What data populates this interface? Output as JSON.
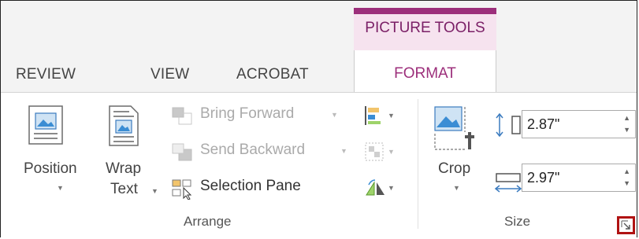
{
  "contextual_tab": {
    "label": "PICTURE TOOLS",
    "color": "#9c2f7b"
  },
  "tabs": [
    {
      "label": "REVIEW"
    },
    {
      "label": "VIEW"
    },
    {
      "label": "ACROBAT"
    },
    {
      "label": "FORMAT",
      "active": true
    }
  ],
  "arrange": {
    "position_label": "Position",
    "wrap_text_line1": "Wrap",
    "wrap_text_line2": "Text",
    "bring_forward": "Bring Forward",
    "send_backward": "Send Backward",
    "selection_pane": "Selection Pane",
    "group_label": "Arrange"
  },
  "size": {
    "crop_label": "Crop",
    "height_value": "2.87\"",
    "width_value": "2.97\"",
    "group_label": "Size"
  },
  "icons": {
    "position": "position-icon",
    "wrap_text": "wrap-text-icon",
    "bring_forward": "bring-forward-icon",
    "send_backward": "send-backward-icon",
    "selection_pane": "selection-pane-icon",
    "align": "align-icon",
    "group": "group-icon",
    "rotate": "rotate-icon",
    "crop": "crop-icon",
    "height": "height-icon",
    "width": "width-icon",
    "launcher": "dialog-launcher-icon"
  }
}
